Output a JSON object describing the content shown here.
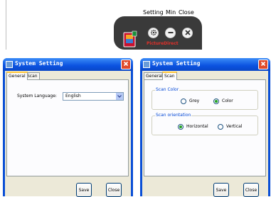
{
  "toolbar": {
    "labels": {
      "setting": "Setting",
      "min": "Min",
      "close": "Close"
    },
    "brand": "PictureDirect"
  },
  "dialog_general": {
    "title": "System Setting",
    "tabs": [
      {
        "label": "General",
        "active": true
      },
      {
        "label": "Scan",
        "active": false
      }
    ],
    "language_label": "System Language:",
    "language_value": "English",
    "save_label": "Save",
    "close_label": "Close"
  },
  "dialog_scan": {
    "title": "System Setting",
    "tabs": [
      {
        "label": "General",
        "active": false
      },
      {
        "label": "Scan",
        "active": true
      }
    ],
    "scan_color": {
      "legend": "Scan Color",
      "options": [
        {
          "label": "Grey",
          "selected": false
        },
        {
          "label": "Color",
          "selected": true
        }
      ]
    },
    "scan_orientation": {
      "legend": "Scan orientation",
      "options": [
        {
          "label": "Horizontal",
          "selected": true
        },
        {
          "label": "Vertical",
          "selected": false
        }
      ]
    },
    "save_label": "Save",
    "close_label": "Close"
  },
  "colors": {
    "title_bar": "#0b52e0",
    "dialog_bg": "#ece9d8",
    "close_button": "#e04a2a",
    "toolbar_bg": "#3a3a3a",
    "brand_text": "#e0302a",
    "radio_dot": "#21a121",
    "group_legend": "#0046d5"
  }
}
